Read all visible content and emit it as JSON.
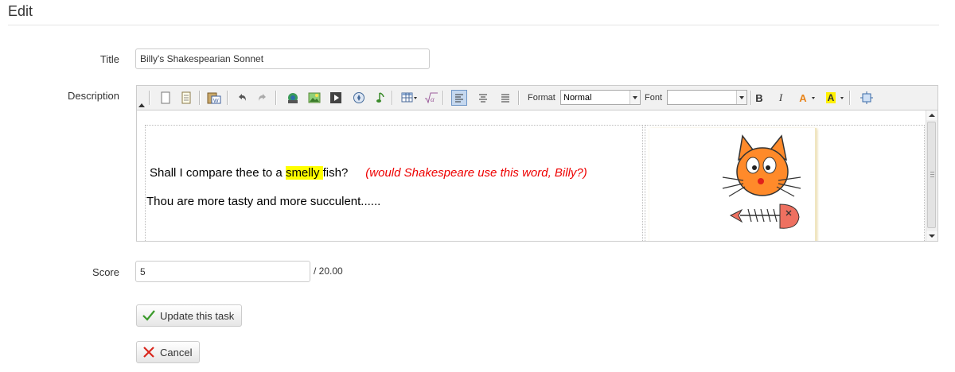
{
  "page": {
    "title": "Edit"
  },
  "form": {
    "title_label": "Title",
    "title_value": "Billy's Shakespearian Sonnet",
    "description_label": "Description",
    "score_label": "Score",
    "score_value": "5",
    "score_suffix": "/ 20.00"
  },
  "toolbar": {
    "buttons": [
      "new-page",
      "preview",
      "paste-from-word",
      "undo",
      "redo",
      "insert-image",
      "insert-picture",
      "insert-media",
      "insert-link",
      "insert-audio",
      "insert-table",
      "insert-math",
      "align-left",
      "align-center",
      "justify",
      "bold",
      "italic",
      "text-color",
      "background-color",
      "maximize"
    ],
    "active_button": "align-left",
    "format_label": "Format",
    "format_value": "Normal",
    "font_label": "Font",
    "font_value": "",
    "bold_glyph": "B",
    "italic_glyph": "I",
    "text_color_glyph": "A",
    "bg_color_glyph": "A"
  },
  "content": {
    "line1_before": "Shall I compare thee to a ",
    "line1_highlight": "smelly ",
    "line1_after": "fish?",
    "line1_note": "(would Shakespeare use this word, Billy?)",
    "line2": "Thou are more tasty and more succulent......",
    "image_subject": "cartoon-cat-with-fish-skeleton"
  },
  "buttons": {
    "update_label": "Update this task",
    "cancel_label": "Cancel"
  },
  "colors": {
    "highlight": "#ffff00",
    "note": "#ee0000",
    "cat": "#ff8a2a",
    "fish": "#ee7060"
  }
}
